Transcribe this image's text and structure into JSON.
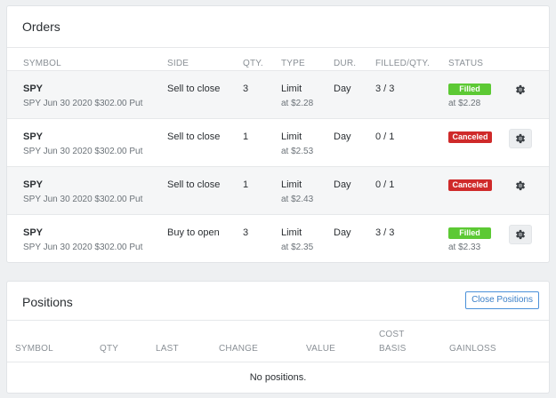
{
  "orders": {
    "title": "Orders",
    "columns": [
      "SYMBOL",
      "SIDE",
      "QTY.",
      "TYPE",
      "DUR.",
      "FILLED/QTY.",
      "STATUS"
    ],
    "rows": [
      {
        "symbol": "SPY",
        "description": "SPY Jun 30 2020 $302.00 Put",
        "side": "Sell to close",
        "qty": "3",
        "type": "Limit",
        "price": "at $2.28",
        "duration": "Day",
        "filled": "3 / 3",
        "status": "Filled",
        "status_price": "at $2.28"
      },
      {
        "symbol": "SPY",
        "description": "SPY Jun 30 2020 $302.00 Put",
        "side": "Sell to close",
        "qty": "1",
        "type": "Limit",
        "price": "at $2.53",
        "duration": "Day",
        "filled": "0 / 1",
        "status": "Canceled",
        "status_price": ""
      },
      {
        "symbol": "SPY",
        "description": "SPY Jun 30 2020 $302.00 Put",
        "side": "Sell to close",
        "qty": "1",
        "type": "Limit",
        "price": "at $2.43",
        "duration": "Day",
        "filled": "0 / 1",
        "status": "Canceled",
        "status_price": ""
      },
      {
        "symbol": "SPY",
        "description": "SPY Jun 30 2020 $302.00 Put",
        "side": "Buy to open",
        "qty": "3",
        "type": "Limit",
        "price": "at $2.35",
        "duration": "Day",
        "filled": "3 / 3",
        "status": "Filled",
        "status_price": "at $2.33"
      }
    ]
  },
  "positions": {
    "title": "Positions",
    "close_button": "Close Positions",
    "columns": [
      "SYMBOL",
      "QTY",
      "LAST",
      "CHANGE",
      "VALUE",
      "COST",
      "BASIS",
      "GAINLOSS"
    ],
    "empty_message": "No positions."
  },
  "colors": {
    "filled": "#5cc934",
    "canceled": "#cf2a2a",
    "accent": "#4a90d9"
  },
  "icons": {
    "settings": "gear-icon"
  }
}
